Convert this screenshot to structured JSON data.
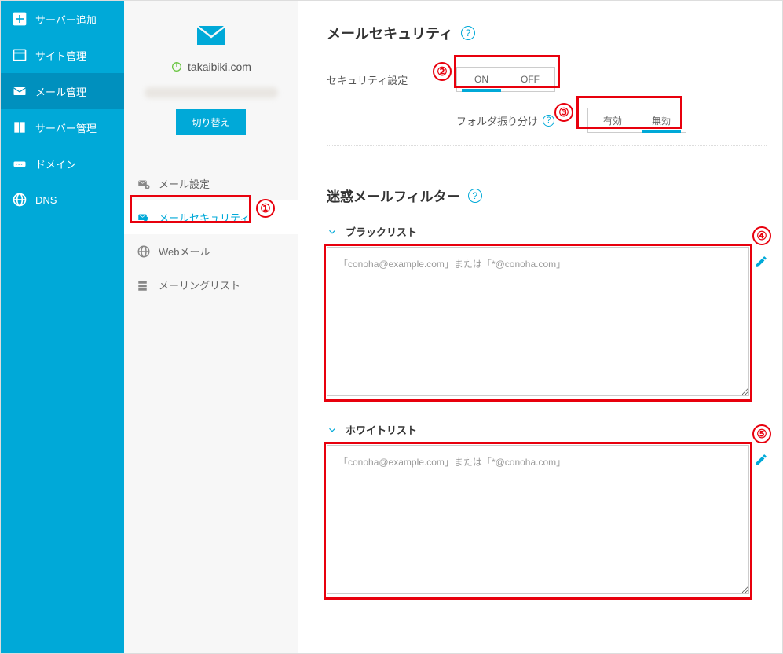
{
  "main_nav": {
    "items": [
      {
        "label": "サーバー追加",
        "name": "nav-add-server"
      },
      {
        "label": "サイト管理",
        "name": "nav-site-manage"
      },
      {
        "label": "メール管理",
        "name": "nav-mail-manage",
        "active": true
      },
      {
        "label": "サーバー管理",
        "name": "nav-server-manage"
      },
      {
        "label": "ドメイン",
        "name": "nav-domain"
      },
      {
        "label": "DNS",
        "name": "nav-dns"
      }
    ]
  },
  "sub_panel": {
    "domain": "takaibiki.com",
    "switch_label": "切り替え",
    "menu": [
      {
        "label": "メール設定",
        "name": "submenu-mail-settings"
      },
      {
        "label": "メールセキュリティ",
        "name": "submenu-mail-security",
        "active": true
      },
      {
        "label": "Webメール",
        "name": "submenu-webmail"
      },
      {
        "label": "メーリングリスト",
        "name": "submenu-mailing-list"
      }
    ]
  },
  "content": {
    "mail_security": {
      "title": "メールセキュリティ",
      "security_setting_label": "セキュリティ設定",
      "toggle1": {
        "on": "ON",
        "off": "OFF",
        "active": "on"
      },
      "folder_sort_label": "フォルダ振り分け",
      "toggle2": {
        "on": "有効",
        "off": "無効",
        "active": "off"
      }
    },
    "spam_filter": {
      "title": "迷惑メールフィルター",
      "blacklist": {
        "header": "ブラックリスト",
        "placeholder": "「conoha@example.com」または「*@conoha.com」"
      },
      "whitelist": {
        "header": "ホワイトリスト",
        "placeholder": "「conoha@example.com」または「*@conoha.com」"
      }
    }
  },
  "annotations": {
    "1": "①",
    "2": "②",
    "3": "③",
    "4": "④",
    "5": "⑤"
  }
}
